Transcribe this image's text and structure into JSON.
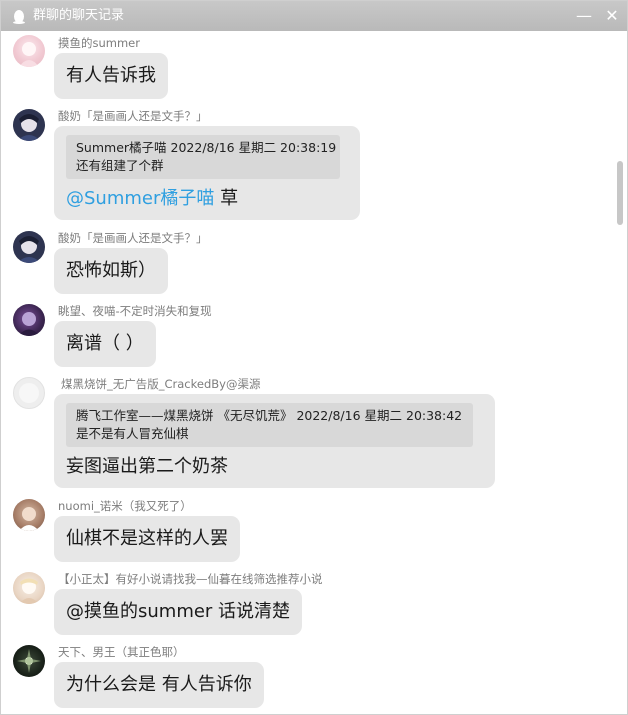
{
  "window": {
    "title": "群聊的聊天记录",
    "min_glyph": "—",
    "close_glyph": "✕"
  },
  "messages": [
    {
      "nick": "摸鱼的summer",
      "text": "有人告诉我"
    },
    {
      "nick": "酸奶「是画画人还是文手？」",
      "quote_head": "Summer橘子喵  2022/8/16 星期二 20:38:19",
      "quote_body": "还有组建了个群",
      "mention": "@Summer橘子喵",
      "text": " 草"
    },
    {
      "nick": "酸奶「是画画人还是文手？」",
      "text": "恐怖如斯）"
    },
    {
      "nick": "眺望、夜喵-不定时消失和复现",
      "text": "离谱（ ）"
    },
    {
      "nick": "煤黑烧饼_无广告版_CrackedBy@渠源",
      "quote_head": "腾飞工作室——煤黑烧饼 《无尽饥荒》  2022/8/16 星期二 20:38:42",
      "quote_body": "是不是有人冒充仙棋",
      "text": "妄图逼出第二个奶茶"
    },
    {
      "nick": "nuomi_诺米（我又死了）",
      "text": "仙棋不是这样的人罢"
    },
    {
      "nick": "【小正太】有好小说请找我—仙暮在线筛选推荐小说",
      "text": "@摸鱼的summer 话说清楚"
    },
    {
      "nick": "天下、男王（其正色耶）",
      "text": "为什么会是 有人告诉你"
    }
  ]
}
